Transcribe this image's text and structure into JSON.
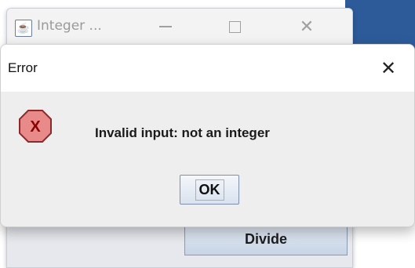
{
  "parent_window": {
    "title": "Integer ...",
    "icon": "java-cup-icon",
    "minimize_icon": "minimize-icon",
    "maximize_icon": "maximize-icon",
    "close_icon": "close-icon",
    "divide_label": "Divide"
  },
  "dialog": {
    "title": "Error",
    "close_glyph": "✕",
    "icon": "error-icon",
    "message": "Invalid input: not an integer",
    "ok_label": "OK"
  },
  "colors": {
    "error_icon_fill": "#e88a8a",
    "error_icon_stroke": "#8b2a2a",
    "error_x": "#8b0000"
  }
}
